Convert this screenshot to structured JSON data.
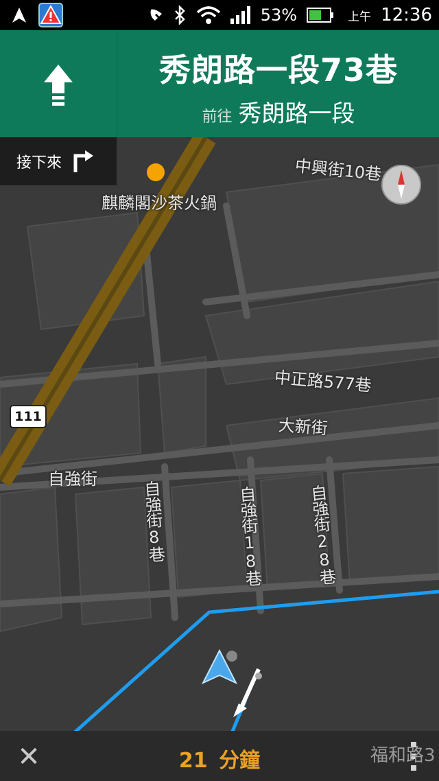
{
  "status_bar": {
    "battery": "53%",
    "ampm": "上午",
    "time": "12:36",
    "icons": [
      "navigation-icon",
      "alert-app-icon",
      "no-sim-icon",
      "bluetooth-icon",
      "wifi-icon",
      "signal-icon",
      "battery-icon"
    ]
  },
  "nav": {
    "current_street": "秀朗路一段73巷",
    "toward_label": "前往",
    "toward_street": "秀朗路一段",
    "maneuver_icon": "straight-arrow-icon"
  },
  "next_turn": {
    "label": "接下來",
    "icon": "turn-right-icon"
  },
  "map": {
    "labels": {
      "poi": "麒麟閣沙茶火鍋",
      "zhongxing": "中興街10巷",
      "zhongzheng": "中正路577巷",
      "daxin": "大新街",
      "ziqiang": "自強街",
      "ziqiang8": "自強街8巷",
      "ziqiang18": "自強街18巷",
      "ziqiang28": "自強街28巷",
      "fuhe": "福和路3"
    },
    "route_shield": "111",
    "route_color": "#1e9df0",
    "highway_color": "#8a6a10"
  },
  "bottom_bar": {
    "eta_value": "21",
    "eta_unit": "分鐘",
    "eta_color": "#f5a623"
  }
}
